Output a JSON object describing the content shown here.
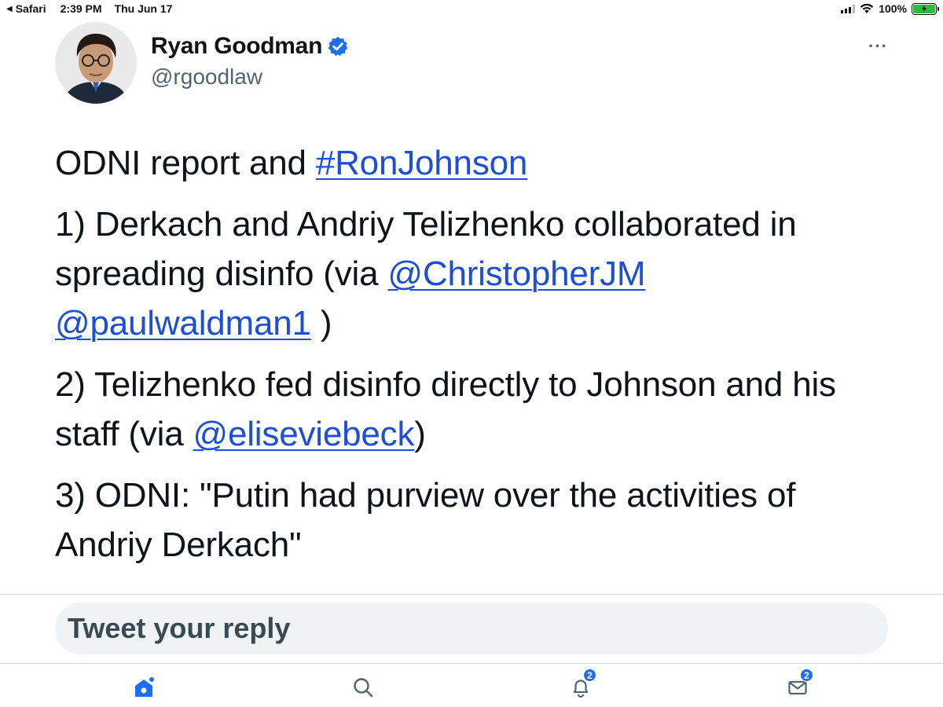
{
  "status_bar": {
    "app": "Safari",
    "time": "2:39 PM",
    "date": "Thu Jun 17",
    "battery": "100%"
  },
  "tweet": {
    "display_name": "Ryan Goodman",
    "handle": "@rgoodlaw",
    "more_label": "···",
    "line1_text": "ODNI report and ",
    "line1_hashtag": "#RonJohnson",
    "p1_text": "1) Derkach and Andriy Telizhenko collaborated in spreading disinfo (via ",
    "p1_mention1": "@ChristopherJM",
    "p1_mention2": "@paulwaldman1",
    "p1_end": " )",
    "p2_text": "2) Telizhenko fed disinfo directly to Johnson and his staff (via ",
    "p2_mention": "@eliseviebeck",
    "p2_end": ")",
    "p3_text": "3) ODNI: \"Putin had purview over the activities of Andriy Derkach\""
  },
  "reply": {
    "placeholder": "Tweet your reply"
  },
  "tab_bar": {
    "notifications_badge": "2",
    "messages_badge": "2"
  },
  "colors": {
    "link": "#1d4ed8",
    "accent": "#1d6ef0"
  }
}
